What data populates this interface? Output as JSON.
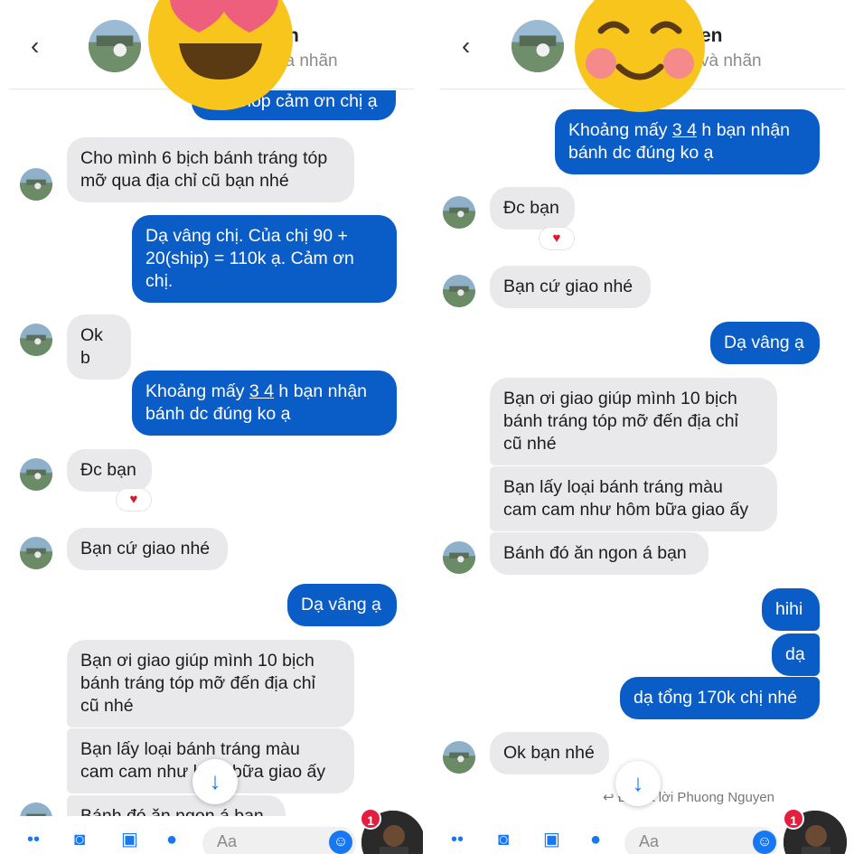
{
  "left": {
    "header": {
      "name_fragment": "n",
      "subtitle": "và nhãn"
    },
    "messages": {
      "m1": "Dạ shop cảm ơn chị ạ",
      "m2": "Cho mình 6 bịch bánh tráng tóp\nmỡ qua địa chỉ cũ bạn nhé",
      "m3": "Dạ vâng chị. Của chị 90 +\n20(ship) = 110k ạ. Cảm ơn\nchị.",
      "m4": "Ok b",
      "m5_a": "Khoảng mấy ",
      "m5_u": "3 4",
      "m5_b": " h bạn nhận\nbánh dc đúng ko ạ",
      "m6": "Đc bạn",
      "m7": "Bạn cứ giao nhé",
      "m8": "Dạ vâng ạ",
      "m9": "Bạn ơi giao giúp mình 10 bịch\nbánh tráng tóp mỡ đến địa chỉ\ncũ nhé",
      "m10": "Bạn lấy loại bánh tráng màu\ncam cam như hôm bữa giao ấy",
      "m11": "Bánh đó ăn ngon á bạn"
    },
    "reaction": "♥",
    "composer": {
      "placeholder": "Aa"
    },
    "badge_count": "1"
  },
  "right": {
    "header": {
      "name_fragment": "en",
      "subtitle": "và nhãn"
    },
    "messages": {
      "m1_a": "Khoảng mấy ",
      "m1_u": "3 4",
      "m1_b": " h bạn nhận\nbánh dc đúng ko ạ",
      "m2": "Đc bạn",
      "m3": "Bạn cứ giao nhé",
      "m4": "Dạ vâng ạ",
      "m5": "Bạn ơi giao giúp mình 10 bịch\nbánh tráng tóp mỡ đến địa chỉ\ncũ nhé",
      "m6": "Bạn lấy loại bánh tráng màu\ncam cam như hôm bữa giao ấy",
      "m7": "Bánh đó ăn ngon á bạn",
      "m8": "hihi",
      "m9": "dạ",
      "m10": "dạ tổng 170k chị nhé",
      "m11": "Ok bạn nhé"
    },
    "reaction": "♥",
    "reply_note": "Đã trả lời Phuong Nguyen",
    "composer": {
      "placeholder": "Aa"
    },
    "badge_count": "1"
  },
  "colors": {
    "outgoing_bubble": "#0a5cc7",
    "incoming_bubble": "#e9e9eb",
    "accent": "#1877f2",
    "badge": "#e41e3f"
  },
  "icons": [
    "back-arrow-icon",
    "heart-icon",
    "scroll-down-icon",
    "camera-icon",
    "gallery-icon",
    "apps-icon",
    "emoji-icon",
    "heart-eyes-emoji",
    "smiling-emoji"
  ]
}
